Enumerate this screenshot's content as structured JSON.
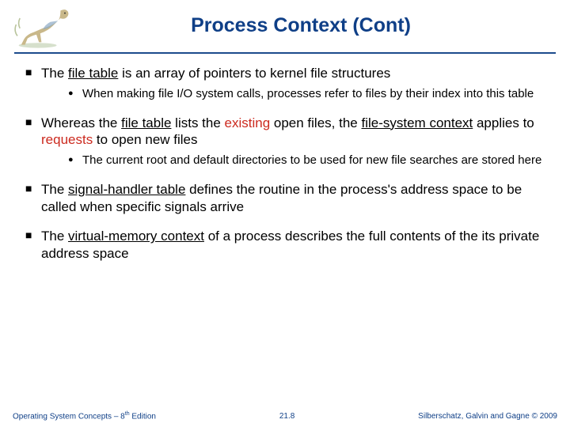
{
  "title": "Process Context (Cont)",
  "bullets": {
    "b1": {
      "pre": "The ",
      "term": "file table",
      "post": " is an array of pointers to kernel file structures",
      "sub": "When making file I/O system calls, processes refer to files by their index into this table"
    },
    "b2": {
      "pre": "Whereas the ",
      "t1": "file table",
      "mid1": " lists the ",
      "r1": "existing",
      "mid2": " open files, the ",
      "t2": "file-system context",
      "mid3": " applies to ",
      "r2": "requests",
      "post": " to open new files",
      "sub": "The current root and default directories to be used for new file searches are stored here"
    },
    "b3": {
      "pre": "The ",
      "term": "signal-handler table",
      "post": " defines the routine in the process's address space to be called when specific signals arrive"
    },
    "b4": {
      "pre": "The ",
      "term": "virtual-memory context",
      "post": " of a process describes the full contents of the its private address space"
    }
  },
  "footer": {
    "left_a": "Operating System Concepts – 8",
    "left_b": " Edition",
    "mid": "21.8",
    "right": "Silberschatz, Galvin and Gagne © 2009"
  }
}
